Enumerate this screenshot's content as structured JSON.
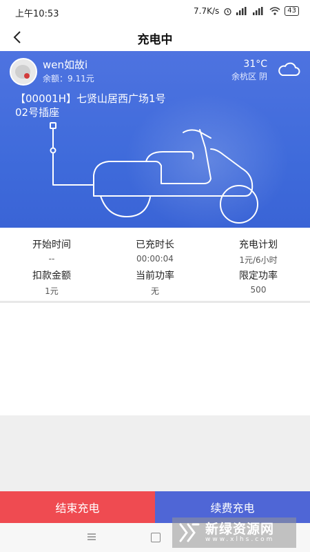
{
  "status_bar": {
    "time": "上午10:53",
    "network_speed": "7.7K/s",
    "battery": "43"
  },
  "header": {
    "title": "充电中"
  },
  "user": {
    "name": "wen如故i",
    "balance": "余额：9.11元"
  },
  "weather": {
    "temperature": "31°C",
    "location": "余杭区 阴",
    "icon": "cloud-icon"
  },
  "station": {
    "line1": "【00001H】七贤山居西广场1号",
    "line2": "02号插座"
  },
  "charging_info": [
    {
      "label": "开始时间",
      "value": "--"
    },
    {
      "label": "已充时长",
      "value": "00:00:04"
    },
    {
      "label": "充电计划",
      "value": "1元/6小时"
    },
    {
      "label": "扣款金额",
      "value": "1元"
    },
    {
      "label": "当前功率",
      "value": "无"
    },
    {
      "label": "限定功率",
      "value": "500"
    }
  ],
  "actions": {
    "end_charge": "结束充电",
    "renew_charge": "续费充电"
  },
  "watermark": {
    "title": "新绿资源网",
    "url": "www.xlhs.com"
  },
  "colors": {
    "hero_blue": "#4570dd",
    "end_button": "#ef4b51",
    "renew_button": "#4f66d6"
  }
}
